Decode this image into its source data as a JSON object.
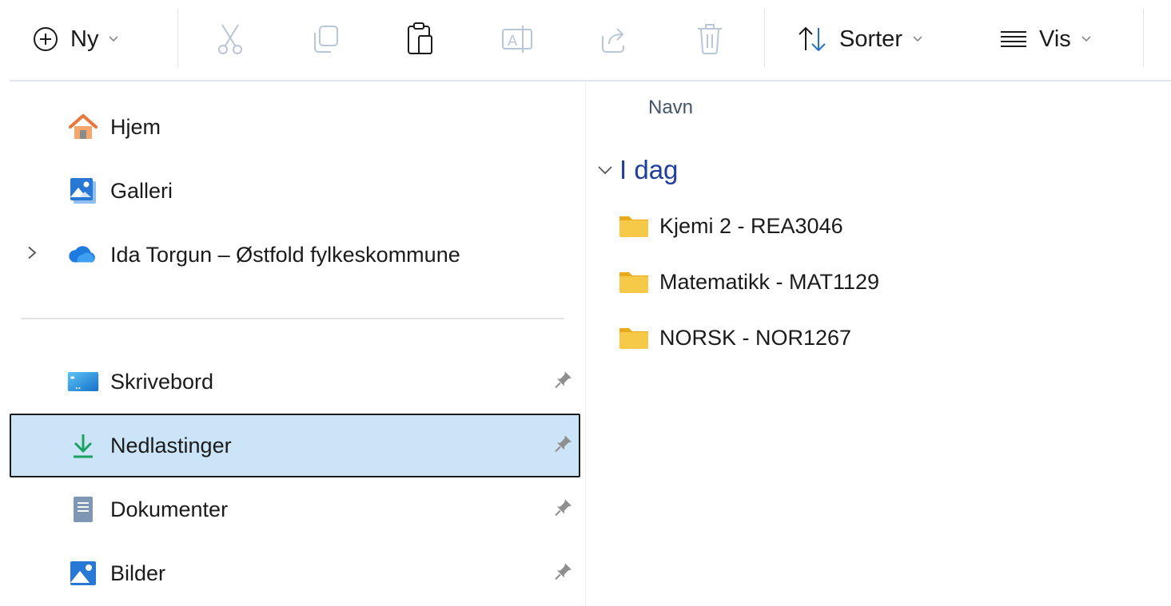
{
  "toolbar": {
    "new_label": "Ny",
    "sort_label": "Sorter",
    "view_label": "Vis"
  },
  "sidebar": {
    "items": [
      {
        "label": "Hjem",
        "icon": "home-icon"
      },
      {
        "label": "Galleri",
        "icon": "gallery-icon"
      },
      {
        "label": "Ida Torgun – Østfold fylkeskommune",
        "icon": "onedrive-cloud-icon",
        "expandable": true
      },
      {
        "label": "Skrivebord",
        "icon": "desktop-icon",
        "pinned": true
      },
      {
        "label": "Nedlastinger",
        "icon": "download-icon",
        "pinned": true,
        "selected": true
      },
      {
        "label": "Dokumenter",
        "icon": "documents-icon",
        "pinned": true
      },
      {
        "label": "Bilder",
        "icon": "pictures-icon",
        "pinned": true
      }
    ]
  },
  "main": {
    "column_header": "Navn",
    "group_label": "I dag",
    "files": [
      {
        "name": "Kjemi 2 - REA3046",
        "icon": "folder-icon"
      },
      {
        "name": "Matematikk - MAT1129",
        "icon": "folder-icon"
      },
      {
        "name": "NORSK - NOR1267",
        "icon": "folder-icon"
      }
    ]
  },
  "colors": {
    "selection_bg": "#cce4f7",
    "group_header": "#1f3f9a",
    "folder_yellow": "#f7c948",
    "download_green": "#1aa260"
  }
}
